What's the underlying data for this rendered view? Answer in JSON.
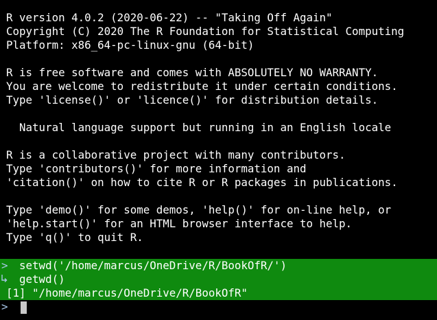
{
  "header": [
    "R version 4.0.2 (2020-06-22) -- \"Taking Off Again\"",
    "Copyright (C) 2020 The R Foundation for Statistical Computing",
    "Platform: x86_64-pc-linux-gnu (64-bit)"
  ],
  "warranty": [
    "R is free software and comes with ABSOLUTELY NO WARRANTY.",
    "You are welcome to redistribute it under certain conditions.",
    "Type 'license()' or 'licence()' for distribution details."
  ],
  "locale_note": "  Natural language support but running in an English locale",
  "collab": [
    "R is a collaborative project with many contributors.",
    "Type 'contributors()' for more information and",
    "'citation()' on how to cite R or R packages in publications."
  ],
  "help": [
    "Type 'demo()' for some demos, 'help()' for on-line help, or",
    "'help.start()' for an HTML browser interface to help.",
    "Type 'q()' to quit R."
  ],
  "console": {
    "prompt_symbol": ">",
    "command1": "  setwd('/home/marcus/OneDrive/R/BookOfR/')",
    "command2": "  getwd()",
    "output1": "[1] \"/home/marcus/OneDrive/R/BookOfR\""
  },
  "colors": {
    "background": "#000000",
    "text": "#ffffff",
    "highlight": "#0f8a0f",
    "prompt": "#a8c8e8",
    "cursor": "#c8c8c8"
  }
}
